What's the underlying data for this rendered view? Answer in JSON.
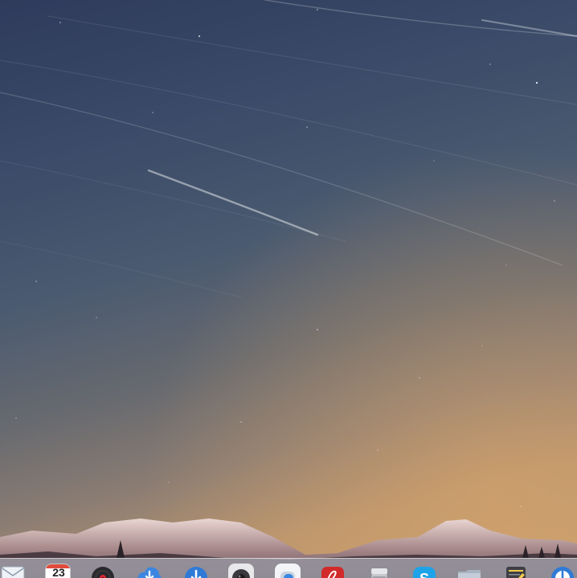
{
  "screen": {
    "name": "macOS desktop",
    "wallpaper": "night-sky-star-trails-over-snowy-mountains"
  },
  "colors": {
    "sky_top": "#2f3b5c",
    "sky_mid": "#4a5a70",
    "horizon_glow": "#c9a06f",
    "dock_background": "#d2d6de"
  },
  "dock": {
    "items": [
      {
        "icon": "mail-icon"
      },
      {
        "icon": "calendar-icon",
        "date": "23"
      },
      {
        "icon": "music-record-icon"
      },
      {
        "icon": "cloud-download-icon"
      },
      {
        "icon": "download-arrow-icon"
      },
      {
        "icon": "camera-app-icon"
      },
      {
        "icon": "chat-bubble-icon"
      },
      {
        "icon": "pdf-reader-icon"
      },
      {
        "icon": "storage-drive-icon"
      },
      {
        "icon": "skype-icon"
      },
      {
        "icon": "folder-icon"
      },
      {
        "icon": "text-editor-icon"
      },
      {
        "icon": "power-gauge-icon"
      }
    ]
  }
}
